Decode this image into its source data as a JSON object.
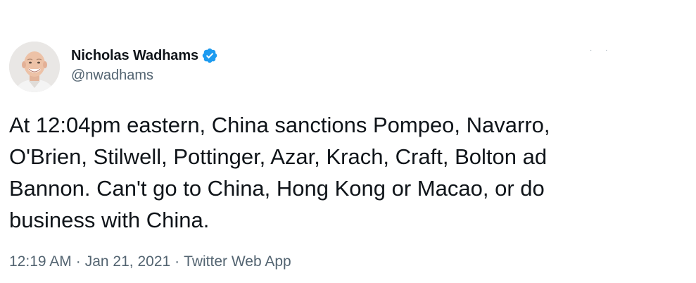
{
  "author": {
    "display_name": "Nicholas Wadhams",
    "handle": "@nwadhams",
    "verified": true,
    "verified_color": "#1d9bf0"
  },
  "tweet": {
    "text": "At 12:04pm eastern, China sanctions Pompeo, Navarro,\nO'Brien, Stilwell, Pottinger, Azar, Krach, Craft, Bolton ad\nBannon. Can't go to China, Hong Kong or Macao, or do\nbusiness with China."
  },
  "meta": {
    "time": "12:19 AM",
    "separator": "·",
    "date": "Jan 21, 2021",
    "source": "Twitter Web App"
  },
  "icons": {
    "verified": "verified-badge-icon",
    "more": "more-options-icon"
  }
}
